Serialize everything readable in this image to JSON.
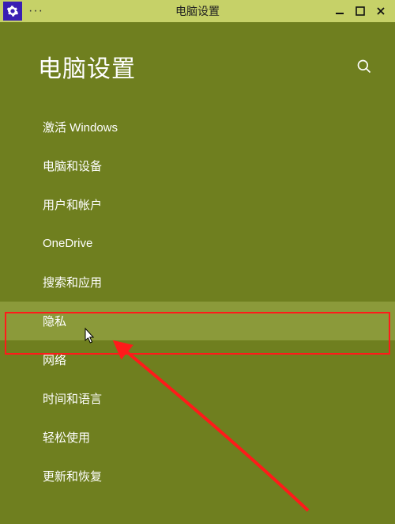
{
  "titlebar": {
    "title": "电脑设置",
    "overflow": "···"
  },
  "header": {
    "page_title": "电脑设置"
  },
  "nav": {
    "items": [
      {
        "label": "激活 Windows"
      },
      {
        "label": "电脑和设备"
      },
      {
        "label": "用户和帐户"
      },
      {
        "label": "OneDrive"
      },
      {
        "label": "搜索和应用"
      },
      {
        "label": "隐私"
      },
      {
        "label": "网络"
      },
      {
        "label": "时间和语言"
      },
      {
        "label": "轻松使用"
      },
      {
        "label": "更新和恢复"
      }
    ],
    "selected_index": 5
  }
}
